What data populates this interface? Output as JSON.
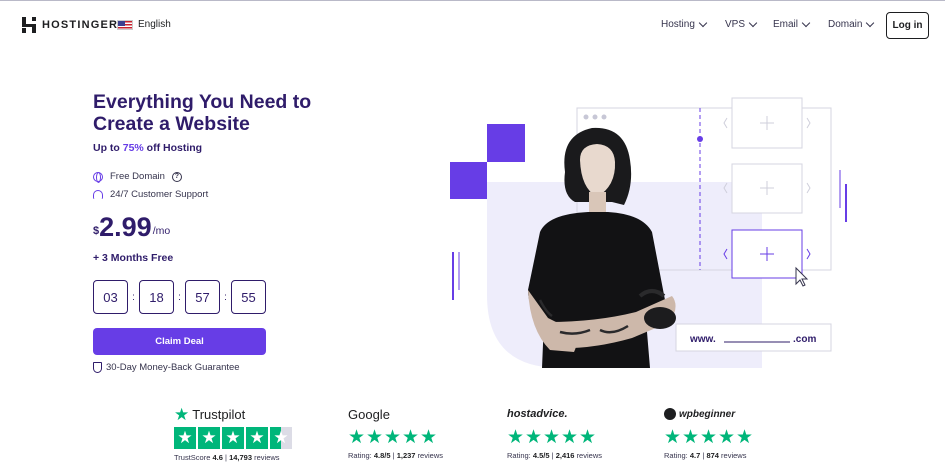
{
  "header": {
    "brand": "HOSTINGER",
    "language": "English",
    "nav": [
      "Hosting",
      "VPS",
      "Email",
      "Domain"
    ],
    "login_label": "Log in"
  },
  "hero": {
    "title": "Everything You Need to Create a Website",
    "subtitle_prefix": "Up to ",
    "subtitle_accent": "75%",
    "subtitle_suffix": " off Hosting",
    "features": [
      "Free Domain",
      "24/7 Customer Support"
    ],
    "price_currency": "$",
    "price_amount": "2.99",
    "price_period": "/mo",
    "bonus": "+ 3 Months Free",
    "timer": [
      "03",
      "18",
      "57",
      "55"
    ],
    "timer_separator": ":",
    "cta_label": "Claim Deal",
    "guarantee": "30-Day Money-Back Guarantee"
  },
  "illustration": {
    "url_prefix": "www.",
    "url_suffix": ".com",
    "accent_color": "#673de6"
  },
  "ratings": [
    {
      "name": "Trustpilot",
      "meta_label": "TrustScore",
      "score": "4.6",
      "sep": "|",
      "reviews": "14,793",
      "reviews_label": "reviews"
    },
    {
      "name": "Google",
      "meta_label": "Rating:",
      "score": "4.8/5",
      "sep": "|",
      "reviews": "1,237",
      "reviews_label": "reviews"
    },
    {
      "name": "hostadvice.",
      "meta_label": "Rating:",
      "score": "4.5/5",
      "sep": "|",
      "reviews": "2,416",
      "reviews_label": "reviews"
    },
    {
      "name": "wpbeginner",
      "meta_label": "Rating:",
      "score": "4.7",
      "sep": "|",
      "reviews": "874",
      "reviews_label": "reviews"
    }
  ]
}
